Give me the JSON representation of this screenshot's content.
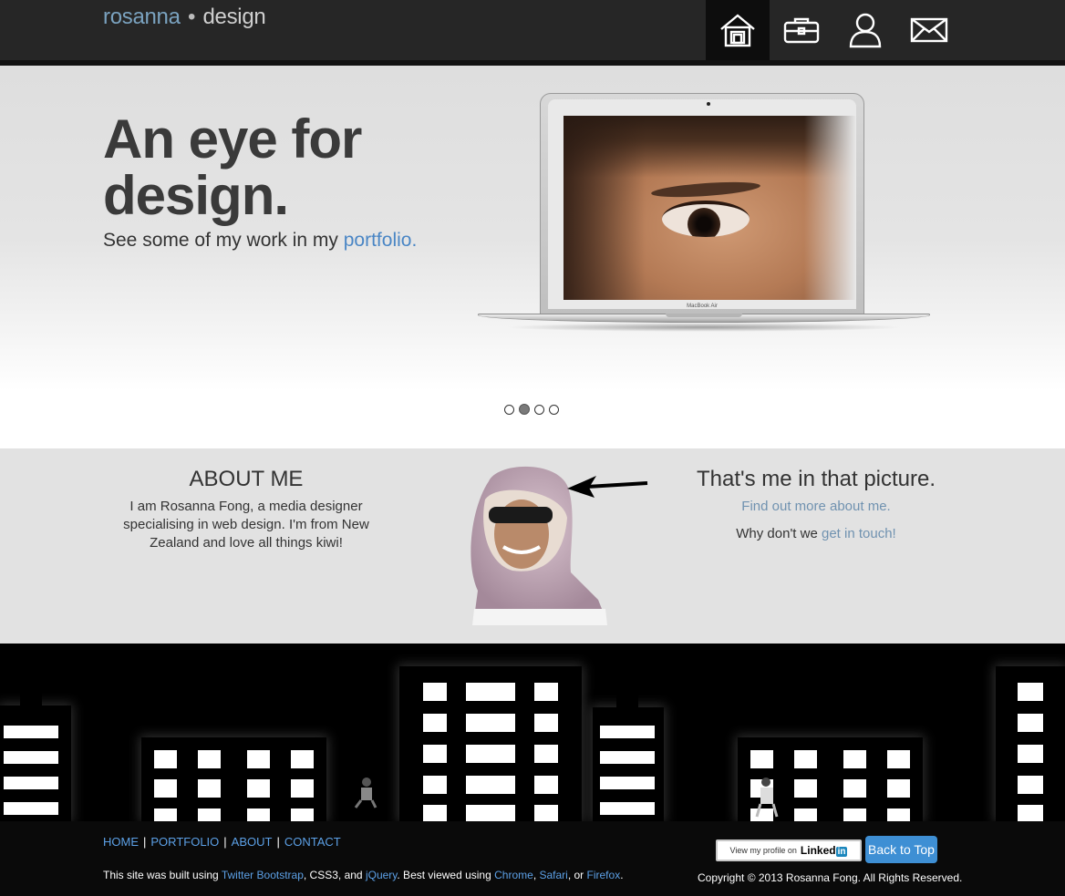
{
  "brand": {
    "part1": "rosanna",
    "dot": "•",
    "part2": "design"
  },
  "nav": [
    {
      "name": "home-icon",
      "active": true
    },
    {
      "name": "briefcase-icon",
      "active": false
    },
    {
      "name": "user-icon",
      "active": false
    },
    {
      "name": "mail-icon",
      "active": false
    }
  ],
  "hero": {
    "title": "An eye for design.",
    "subtitle_prefix": "See some of my work in my ",
    "subtitle_link": "portfolio.",
    "laptop_label": "MacBook Air",
    "carousel_active": 2,
    "carousel_count": 4
  },
  "about": {
    "heading": "ABOUT ME",
    "text": "I am Rosanna Fong, a media designer specialising in web design. I'm from New Zealand and love all things kiwi!",
    "me_heading": "That's me in that picture.",
    "find_out": "Find out more about me.",
    "touch_prefix": "Why don't we ",
    "touch_link": "get in touch!"
  },
  "footer": {
    "links": [
      "HOME",
      "PORTFOLIO",
      "ABOUT",
      "CONTACT"
    ],
    "built": {
      "t1": "This site was built using ",
      "l1": "Twitter Bootstrap",
      "t2": ", CSS3, and ",
      "l2": "jQuery",
      "t3": ". Best viewed using ",
      "l3": "Chrome",
      "t4": ", ",
      "l4": "Safari",
      "t5": ", or ",
      "l5": "Firefox",
      "t6": "."
    },
    "linkedin_prefix": "View my profile on",
    "linkedin_brand": "Linked",
    "linkedin_in": "in",
    "back_to_top": "Back to Top",
    "copyright": "Copyright © 2013 Rosanna Fong. All Rights Reserved."
  },
  "colors": {
    "link": "#5ca0e6",
    "accent": "#3e8fd4",
    "navbar": "#262626"
  }
}
